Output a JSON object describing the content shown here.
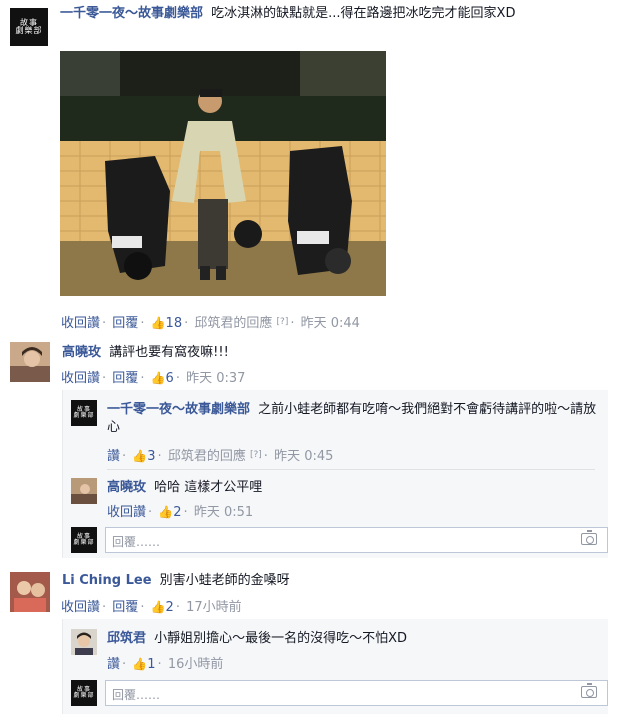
{
  "comment1": {
    "author": "一千零一夜～故事劇樂部",
    "text": "吃冰淇淋的缺點就是...得在路邊把冰吃完才能回家XD",
    "unlike": "收回讚",
    "reply": "回覆",
    "likes": "18",
    "replier": "邱筑君的回應",
    "bracket": "[?]",
    "time": "昨天 0:44"
  },
  "comment2": {
    "author": "高曉玫",
    "text": "講評也要有窩夜嘛!!!",
    "unlike": "收回讚",
    "reply": "回覆",
    "likes": "6",
    "time": "昨天 0:37",
    "replies": [
      {
        "author": "一千零一夜～故事劇樂部",
        "text": "之前小蛙老師都有吃唷～我們絕對不會虧待講評的啦～請放心",
        "like": "讚",
        "likes": "3",
        "replier": "邱筑君的回應",
        "bracket": "[?]",
        "time": "昨天 0:45"
      },
      {
        "author": "高曉玫",
        "text": "哈哈 這樣才公平哩",
        "unlike": "收回讚",
        "likes": "2",
        "time": "昨天 0:51"
      }
    ],
    "reply_placeholder": "回覆……"
  },
  "comment3": {
    "author": "Li Ching Lee",
    "text": "別害小蛙老師的金嗓呀",
    "unlike": "收回讚",
    "reply": "回覆",
    "likes": "2",
    "time": "17小時前",
    "replies": [
      {
        "author": "邱筑君",
        "text": "小靜姐別擔心～最後一名的沒得吃～不怕XD",
        "like": "讚",
        "likes": "1",
        "time": "16小時前"
      }
    ],
    "reply_placeholder": "回覆……"
  },
  "icons": {
    "like": "thumbs-up-icon",
    "camera": "camera-icon"
  },
  "colors": {
    "link": "#3b5998",
    "meta": "#9197a3",
    "panel": "#f6f7f9"
  }
}
